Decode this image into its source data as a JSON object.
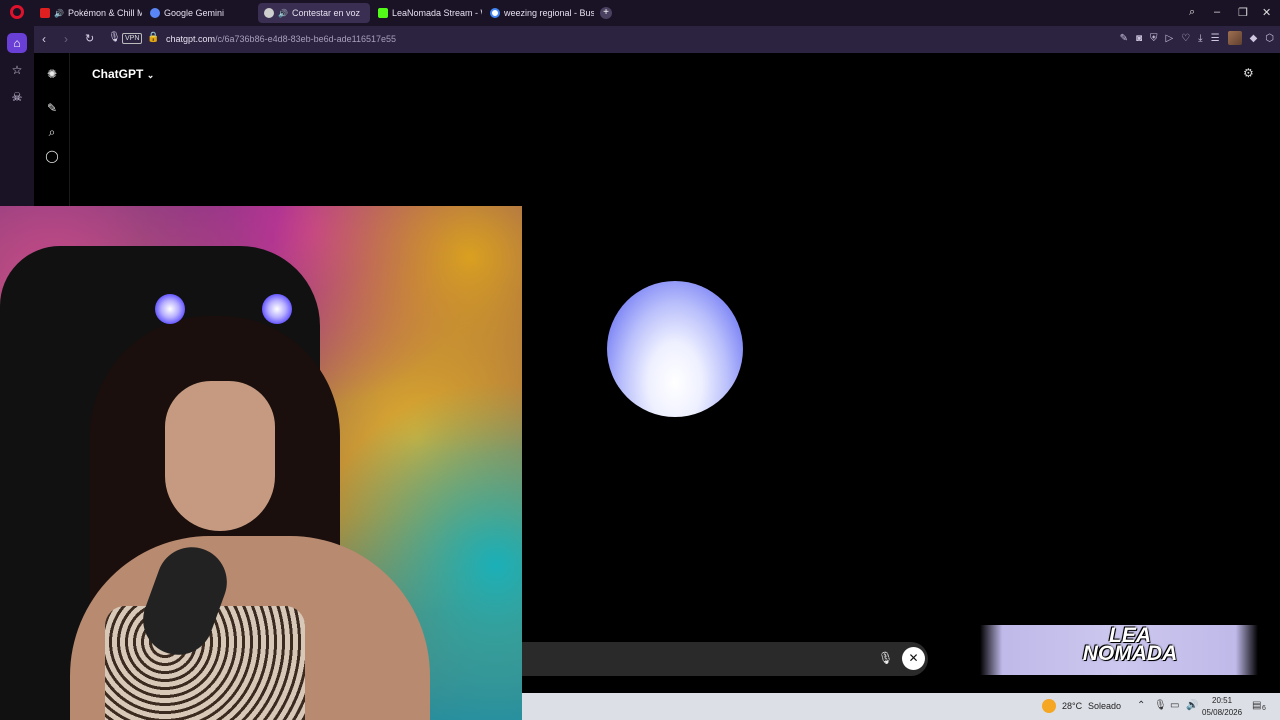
{
  "browser": {
    "tabs": [
      {
        "label": "Pokémon & Chill Mix |",
        "favicon_color": "#e02020"
      },
      {
        "label": "Google Gemini",
        "favicon_color": "#5a86f5"
      },
      {
        "label": "Contestar en voz",
        "favicon_color": "#cfcfcf"
      },
      {
        "label": "LeaNomada Stream - Wat",
        "favicon_color": "#53fc18"
      },
      {
        "label": "weezing regional - Buscar",
        "favicon_color": "#4285f4"
      }
    ],
    "url_host": "chatgpt.com",
    "url_path": "/c/6a736b86-e4d8-83eb-be6d-ade116517e55",
    "vpn_label": "VPN"
  },
  "chatgpt": {
    "title": "ChatGPT"
  },
  "overlay": {
    "logo_text": "LEA NOMADA"
  },
  "taskbar": {
    "temperature": "28°C",
    "condition": "Soleado",
    "time": "20:51",
    "date": "05/08/2026",
    "notification_count": "6"
  }
}
